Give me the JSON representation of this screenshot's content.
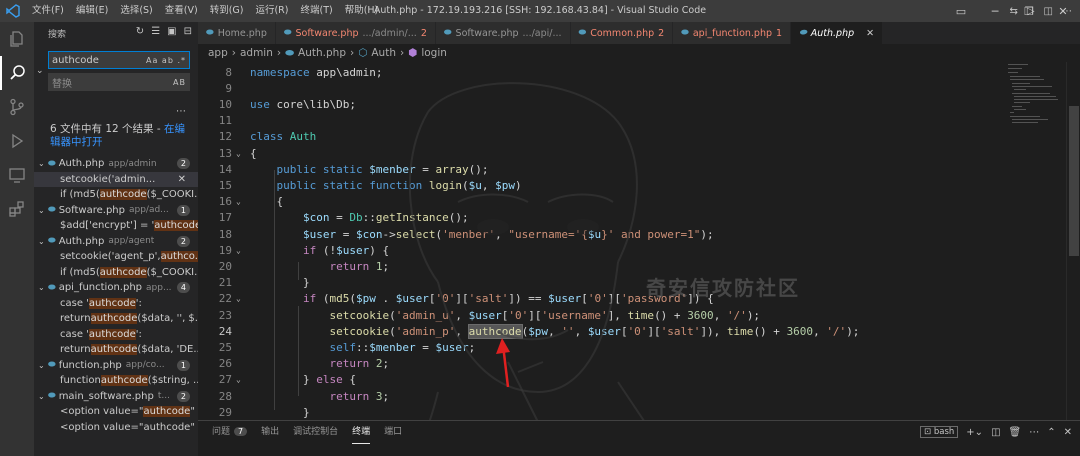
{
  "window": {
    "title": "Auth.php - 172.19.193.216 [SSH: 192.168.43.84] - Visual Studio Code",
    "menu": [
      "文件(F)",
      "编辑(E)",
      "选择(S)",
      "查看(V)",
      "转到(G)",
      "运行(R)",
      "终端(T)",
      "帮助(H)"
    ]
  },
  "sidebar": {
    "title": "搜索",
    "search_value": "authcode",
    "search_opts": "Aa ab .*",
    "replace_placeholder": "替换",
    "replace_opts": "AB",
    "summary": "6 文件中有 12 个结果 - ",
    "summary_link": "在编辑器中打开",
    "results": [
      {
        "kind": "file",
        "name": "Auth.php",
        "path": "app/admin",
        "count": "2"
      },
      {
        "kind": "match",
        "pre": "setcookie('admin...",
        "hl": "",
        "post": "",
        "selected": true
      },
      {
        "kind": "match",
        "pre": "if (md5(",
        "hl": "authcode",
        "post": "($_COOKI..."
      },
      {
        "kind": "file",
        "name": "Software.php",
        "path": "app/ad...",
        "count": "1"
      },
      {
        "kind": "match",
        "pre": "$add['encrypt'] = '",
        "hl": "authcode",
        "post": "';"
      },
      {
        "kind": "file",
        "name": "Auth.php",
        "path": "app/agent",
        "count": "2"
      },
      {
        "kind": "match",
        "pre": "setcookie('agent_p', ",
        "hl": "authco...",
        "post": ""
      },
      {
        "kind": "match",
        "pre": "if (md5(",
        "hl": "authcode",
        "post": "($_COOKI..."
      },
      {
        "kind": "file",
        "name": "api_function.php",
        "path": "app...",
        "count": "4"
      },
      {
        "kind": "match",
        "pre": "case '",
        "hl": "authcode",
        "post": "':"
      },
      {
        "kind": "match",
        "pre": "return ",
        "hl": "authcode",
        "post": "($data, '', $..."
      },
      {
        "kind": "match",
        "pre": "case '",
        "hl": "authcode",
        "post": "':"
      },
      {
        "kind": "match",
        "pre": "return ",
        "hl": "authcode",
        "post": "($data, 'DE..."
      },
      {
        "kind": "file",
        "name": "function.php",
        "path": "app/co...",
        "count": "1"
      },
      {
        "kind": "match",
        "pre": "function ",
        "hl": "authcode",
        "post": "($string, ..."
      },
      {
        "kind": "file",
        "name": "main_software.php",
        "path": "t...",
        "count": "2"
      },
      {
        "kind": "match",
        "pre": "<option value=\"",
        "hl": "authcode",
        "post": "\" ..."
      },
      {
        "kind": "match",
        "pre": "<option value=\"authcode\" ...",
        "hl": "",
        "post": ""
      }
    ]
  },
  "tabs": [
    {
      "label": "Home.php",
      "dir": "",
      "num": "",
      "err": false,
      "active": false
    },
    {
      "label": "Software.php",
      "dir": ".../admin/...",
      "num": "2",
      "err": true,
      "active": false
    },
    {
      "label": "Software.php",
      "dir": ".../api/...",
      "num": "",
      "err": false,
      "active": false
    },
    {
      "label": "Common.php",
      "dir": "",
      "num": "2",
      "err": true,
      "active": false
    },
    {
      "label": "api_function.php",
      "dir": "",
      "num": "1",
      "err": true,
      "active": false
    },
    {
      "label": "Auth.php",
      "dir": "",
      "num": "",
      "err": false,
      "active": true
    }
  ],
  "breadcrumb": [
    "app",
    "admin",
    "Auth.php",
    "Auth",
    "login"
  ],
  "editor": {
    "current_line": "24",
    "lines": [
      {
        "n": "8",
        "t": [
          [
            "kw",
            "namespace"
          ],
          [
            "ph",
            " app\\admin;"
          ]
        ]
      },
      {
        "n": "9",
        "t": []
      },
      {
        "n": "10",
        "t": [
          [
            "kw",
            "use"
          ],
          [
            "ph",
            " core\\lib\\Db;"
          ]
        ]
      },
      {
        "n": "11",
        "t": []
      },
      {
        "n": "12",
        "t": [
          [
            "kw",
            "class"
          ],
          [
            "ph",
            " "
          ],
          [
            "cls",
            "Auth"
          ]
        ]
      },
      {
        "n": "13",
        "t": [
          [
            "ph",
            "{"
          ]
        ]
      },
      {
        "n": "14",
        "t": [
          [
            "ph",
            "    "
          ],
          [
            "kw",
            "public static"
          ],
          [
            "ph",
            " "
          ],
          [
            "var",
            "$menber"
          ],
          [
            "ph",
            " = "
          ],
          [
            "fn",
            "array"
          ],
          [
            "ph",
            "();"
          ]
        ]
      },
      {
        "n": "15",
        "t": [
          [
            "ph",
            "    "
          ],
          [
            "kw",
            "public static function"
          ],
          [
            "ph",
            " "
          ],
          [
            "fn",
            "login"
          ],
          [
            "ph",
            "("
          ],
          [
            "var",
            "$u"
          ],
          [
            "ph",
            ", "
          ],
          [
            "var",
            "$pw"
          ],
          [
            "ph",
            ")"
          ]
        ]
      },
      {
        "n": "16",
        "t": [
          [
            "ph",
            "    {"
          ]
        ]
      },
      {
        "n": "17",
        "t": [
          [
            "ph",
            "        "
          ],
          [
            "var",
            "$con"
          ],
          [
            "ph",
            " = "
          ],
          [
            "cls",
            "Db"
          ],
          [
            "ph",
            "::"
          ],
          [
            "fn",
            "getInstance"
          ],
          [
            "ph",
            "();"
          ]
        ]
      },
      {
        "n": "18",
        "t": [
          [
            "ph",
            "        "
          ],
          [
            "var",
            "$user"
          ],
          [
            "ph",
            " = "
          ],
          [
            "var",
            "$con"
          ],
          [
            "ph",
            "->"
          ],
          [
            "fn",
            "select"
          ],
          [
            "ph",
            "("
          ],
          [
            "str",
            "'menber'"
          ],
          [
            "ph",
            ", "
          ],
          [
            "str",
            "\"username='{"
          ],
          [
            "var",
            "$u"
          ],
          [
            "str",
            "}' and power=1\""
          ],
          [
            "ph",
            ");"
          ]
        ]
      },
      {
        "n": "19",
        "t": [
          [
            "ph",
            "        "
          ],
          [
            "ctrl",
            "if"
          ],
          [
            "ph",
            " (!"
          ],
          [
            "var",
            "$user"
          ],
          [
            "ph",
            ") {"
          ]
        ]
      },
      {
        "n": "20",
        "t": [
          [
            "ph",
            "            "
          ],
          [
            "ctrl",
            "return"
          ],
          [
            "ph",
            " "
          ],
          [
            "num",
            "1"
          ],
          [
            "ph",
            ";"
          ]
        ]
      },
      {
        "n": "21",
        "t": [
          [
            "ph",
            "        }"
          ]
        ]
      },
      {
        "n": "22",
        "t": [
          [
            "ph",
            "        "
          ],
          [
            "ctrl",
            "if"
          ],
          [
            "ph",
            " ("
          ],
          [
            "fn",
            "md5"
          ],
          [
            "ph",
            "("
          ],
          [
            "var",
            "$pw"
          ],
          [
            "ph",
            " . "
          ],
          [
            "var",
            "$user"
          ],
          [
            "ph",
            "["
          ],
          [
            "str",
            "'0'"
          ],
          [
            "ph",
            "]["
          ],
          [
            "str",
            "'salt'"
          ],
          [
            "ph",
            "]) == "
          ],
          [
            "var",
            "$user"
          ],
          [
            "ph",
            "["
          ],
          [
            "str",
            "'0'"
          ],
          [
            "ph",
            "]["
          ],
          [
            "str",
            "'password'"
          ],
          [
            "ph",
            "]) {"
          ]
        ]
      },
      {
        "n": "23",
        "t": [
          [
            "ph",
            "            "
          ],
          [
            "fn",
            "setcookie"
          ],
          [
            "ph",
            "("
          ],
          [
            "str",
            "'admin_u'"
          ],
          [
            "ph",
            ", "
          ],
          [
            "var",
            "$user"
          ],
          [
            "ph",
            "["
          ],
          [
            "str",
            "'0'"
          ],
          [
            "ph",
            "]["
          ],
          [
            "str",
            "'username'"
          ],
          [
            "ph",
            "], "
          ],
          [
            "fn",
            "time"
          ],
          [
            "ph",
            "() + "
          ],
          [
            "num",
            "3600"
          ],
          [
            "ph",
            ", "
          ],
          [
            "str",
            "'/'"
          ],
          [
            "ph",
            ");"
          ]
        ]
      },
      {
        "n": "24",
        "t": [
          [
            "ph",
            "            "
          ],
          [
            "fn",
            "setcookie"
          ],
          [
            "ph",
            "("
          ],
          [
            "str",
            "'admin_p'"
          ],
          [
            "ph",
            ", "
          ],
          [
            "hlw",
            "authcode"
          ],
          [
            "ph",
            "("
          ],
          [
            "var",
            "$pw"
          ],
          [
            "ph",
            ", "
          ],
          [
            "str",
            "''"
          ],
          [
            "ph",
            ", "
          ],
          [
            "var",
            "$user"
          ],
          [
            "ph",
            "["
          ],
          [
            "str",
            "'0'"
          ],
          [
            "ph",
            "]["
          ],
          [
            "str",
            "'salt'"
          ],
          [
            "ph",
            "]), "
          ],
          [
            "fn",
            "time"
          ],
          [
            "ph",
            "() + "
          ],
          [
            "num",
            "3600"
          ],
          [
            "ph",
            ", "
          ],
          [
            "str",
            "'/'"
          ],
          [
            "ph",
            ");"
          ]
        ]
      },
      {
        "n": "25",
        "t": [
          [
            "ph",
            "            "
          ],
          [
            "kw",
            "self"
          ],
          [
            "ph",
            "::"
          ],
          [
            "var",
            "$menber"
          ],
          [
            "ph",
            " = "
          ],
          [
            "var",
            "$user"
          ],
          [
            "ph",
            ";"
          ]
        ]
      },
      {
        "n": "26",
        "t": [
          [
            "ph",
            "            "
          ],
          [
            "ctrl",
            "return"
          ],
          [
            "ph",
            " "
          ],
          [
            "num",
            "2"
          ],
          [
            "ph",
            ";"
          ]
        ]
      },
      {
        "n": "27",
        "t": [
          [
            "ph",
            "        } "
          ],
          [
            "ctrl",
            "else"
          ],
          [
            "ph",
            " {"
          ]
        ]
      },
      {
        "n": "28",
        "t": [
          [
            "ph",
            "            "
          ],
          [
            "ctrl",
            "return"
          ],
          [
            "ph",
            " "
          ],
          [
            "num",
            "3"
          ],
          [
            "ph",
            ";"
          ]
        ]
      },
      {
        "n": "29",
        "t": [
          [
            "ph",
            "        }"
          ]
        ]
      }
    ]
  },
  "watermark": "奇安信攻防社区",
  "panel": {
    "tabs": [
      "问题",
      "输出",
      "调试控制台",
      "终端",
      "端口"
    ],
    "problems_count": "7",
    "active_tab": "终端",
    "shell": "bash"
  },
  "colors": {
    "accent": "#007acc",
    "highlight": "#613214",
    "arrow": "#e02020"
  }
}
